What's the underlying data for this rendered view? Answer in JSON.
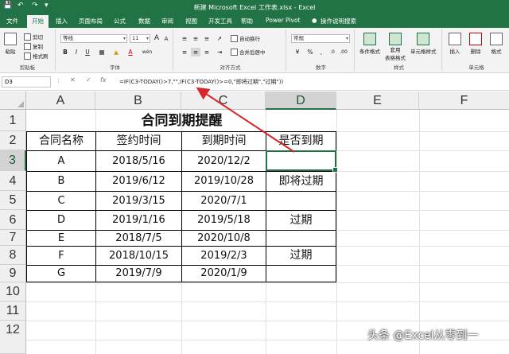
{
  "titlebar": {
    "qa_save_icon": "save-icon",
    "qa_undo_icon": "undo-icon",
    "qa_redo_icon": "redo-icon",
    "title": "新建 Microsoft Excel 工作表.xlsx  -  Excel"
  },
  "tabs": [
    "文件",
    "开始",
    "插入",
    "页面布局",
    "公式",
    "数据",
    "审阅",
    "视图",
    "开发工具",
    "帮助",
    "Power Pivot",
    "操作说明搜索"
  ],
  "ribbon": {
    "clipboard": {
      "paste": "粘贴",
      "cut": "剪切",
      "copy": "复制",
      "painter": "格式刷",
      "label": "剪贴板"
    },
    "font": {
      "family": "等线",
      "size": "11",
      "bold": "B",
      "italic": "I",
      "underline": "U",
      "grow": "A",
      "shrink": "A",
      "color_a": "A",
      "wen": "wén",
      "label": "字体"
    },
    "alignment": {
      "wrap": "自动换行",
      "merge": "合并后居中",
      "label": "对齐方式"
    },
    "number": {
      "format": "常规",
      "label": "数字"
    },
    "styles": {
      "conditional": "条件格式",
      "table": "套用",
      "table2": "表格格式",
      "cell_styles": "单元格样式",
      "label": "样式"
    },
    "cells": {
      "insert": "插入",
      "delete": "删除",
      "format": "格式",
      "label": "单元格"
    }
  },
  "formula_bar": {
    "name_box": "D3",
    "cancel": "✕",
    "enter": "✓",
    "fx": "fx",
    "formula": "=IF(C3-TODAY()>7,\"\",IF(C3-TODAY()>=0,\"即将过期\",\"过期\"))"
  },
  "columns": [
    "A",
    "B",
    "C",
    "D",
    "E",
    "F"
  ],
  "rows": [
    "1",
    "2",
    "3",
    "4",
    "5",
    "6",
    "7",
    "8",
    "9",
    "10",
    "11",
    "12"
  ],
  "sheet": {
    "title": "合同到期提醒",
    "headers": [
      "合同名称",
      "签约时间",
      "到期时间",
      "是否到期"
    ],
    "data": [
      [
        "A",
        "2018/5/16",
        "2020/12/2",
        ""
      ],
      [
        "B",
        "2019/6/12",
        "2019/10/28",
        "即将过期"
      ],
      [
        "C",
        "2019/3/15",
        "2020/7/1",
        ""
      ],
      [
        "D",
        "2019/1/16",
        "2019/5/18",
        "过期"
      ],
      [
        "E",
        "2018/7/5",
        "2020/10/8",
        ""
      ],
      [
        "F",
        "2018/10/15",
        "2019/2/3",
        "过期"
      ],
      [
        "G",
        "2019/7/9",
        "2020/1/9",
        ""
      ]
    ]
  },
  "watermark": "头条 @Excel从零到一",
  "colors": {
    "excel_green": "#217346",
    "arrow": "#d9262c"
  }
}
